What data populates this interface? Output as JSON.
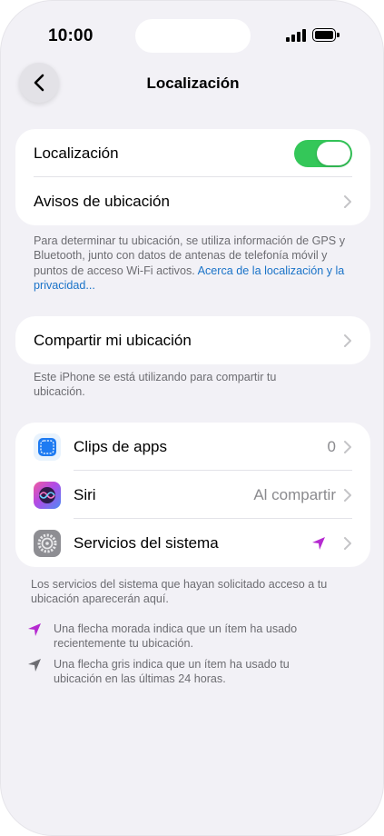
{
  "status_bar": {
    "time": "10:00"
  },
  "nav": {
    "title": "Localización",
    "back_icon": "chevron-left-icon"
  },
  "location_group": {
    "items": [
      {
        "label": "Localización",
        "control": "toggle",
        "on": true
      },
      {
        "label": "Avisos de ubicación",
        "control": "chevron"
      }
    ]
  },
  "location_footnote": {
    "text": "Para determinar tu ubicación, se utiliza información de GPS y Bluetooth, junto con datos de antenas de telefonía móvil y puntos de acceso Wi-Fi activos.",
    "link": "Acerca de la localización y la privacidad..."
  },
  "share_group": {
    "label": "Compartir mi ubicación"
  },
  "share_footnote": "Este iPhone se está utilizando para compartir tu ubicación.",
  "apps_group": {
    "items": [
      {
        "label": "Clips de apps",
        "value": "0",
        "icon": "app-clips-icon"
      },
      {
        "label": "Siri",
        "value": "Al compartir",
        "icon": "siri-icon"
      },
      {
        "label": "Servicios del sistema",
        "value": "",
        "icon": "system-gear-icon",
        "indicator": "location-arrow-purple-icon"
      }
    ]
  },
  "apps_footnote": "Los servicios del sistema que hayan solicitado acceso a tu ubicación aparecerán aquí.",
  "legend": [
    {
      "icon": "location-arrow-purple-icon",
      "text": "Una flecha morada indica que un ítem ha usado recientemente tu ubicación."
    },
    {
      "icon": "location-arrow-gray-icon",
      "text": "Una flecha gris indica que un ítem ha usado tu ubicación en las últimas 24 horas."
    }
  ],
  "colors": {
    "toggle_on": "#34c759",
    "link": "#1a73c8",
    "purple_arrow": "#b52ad0",
    "gray_arrow": "#6d6d72",
    "background": "#f2f1f6"
  }
}
